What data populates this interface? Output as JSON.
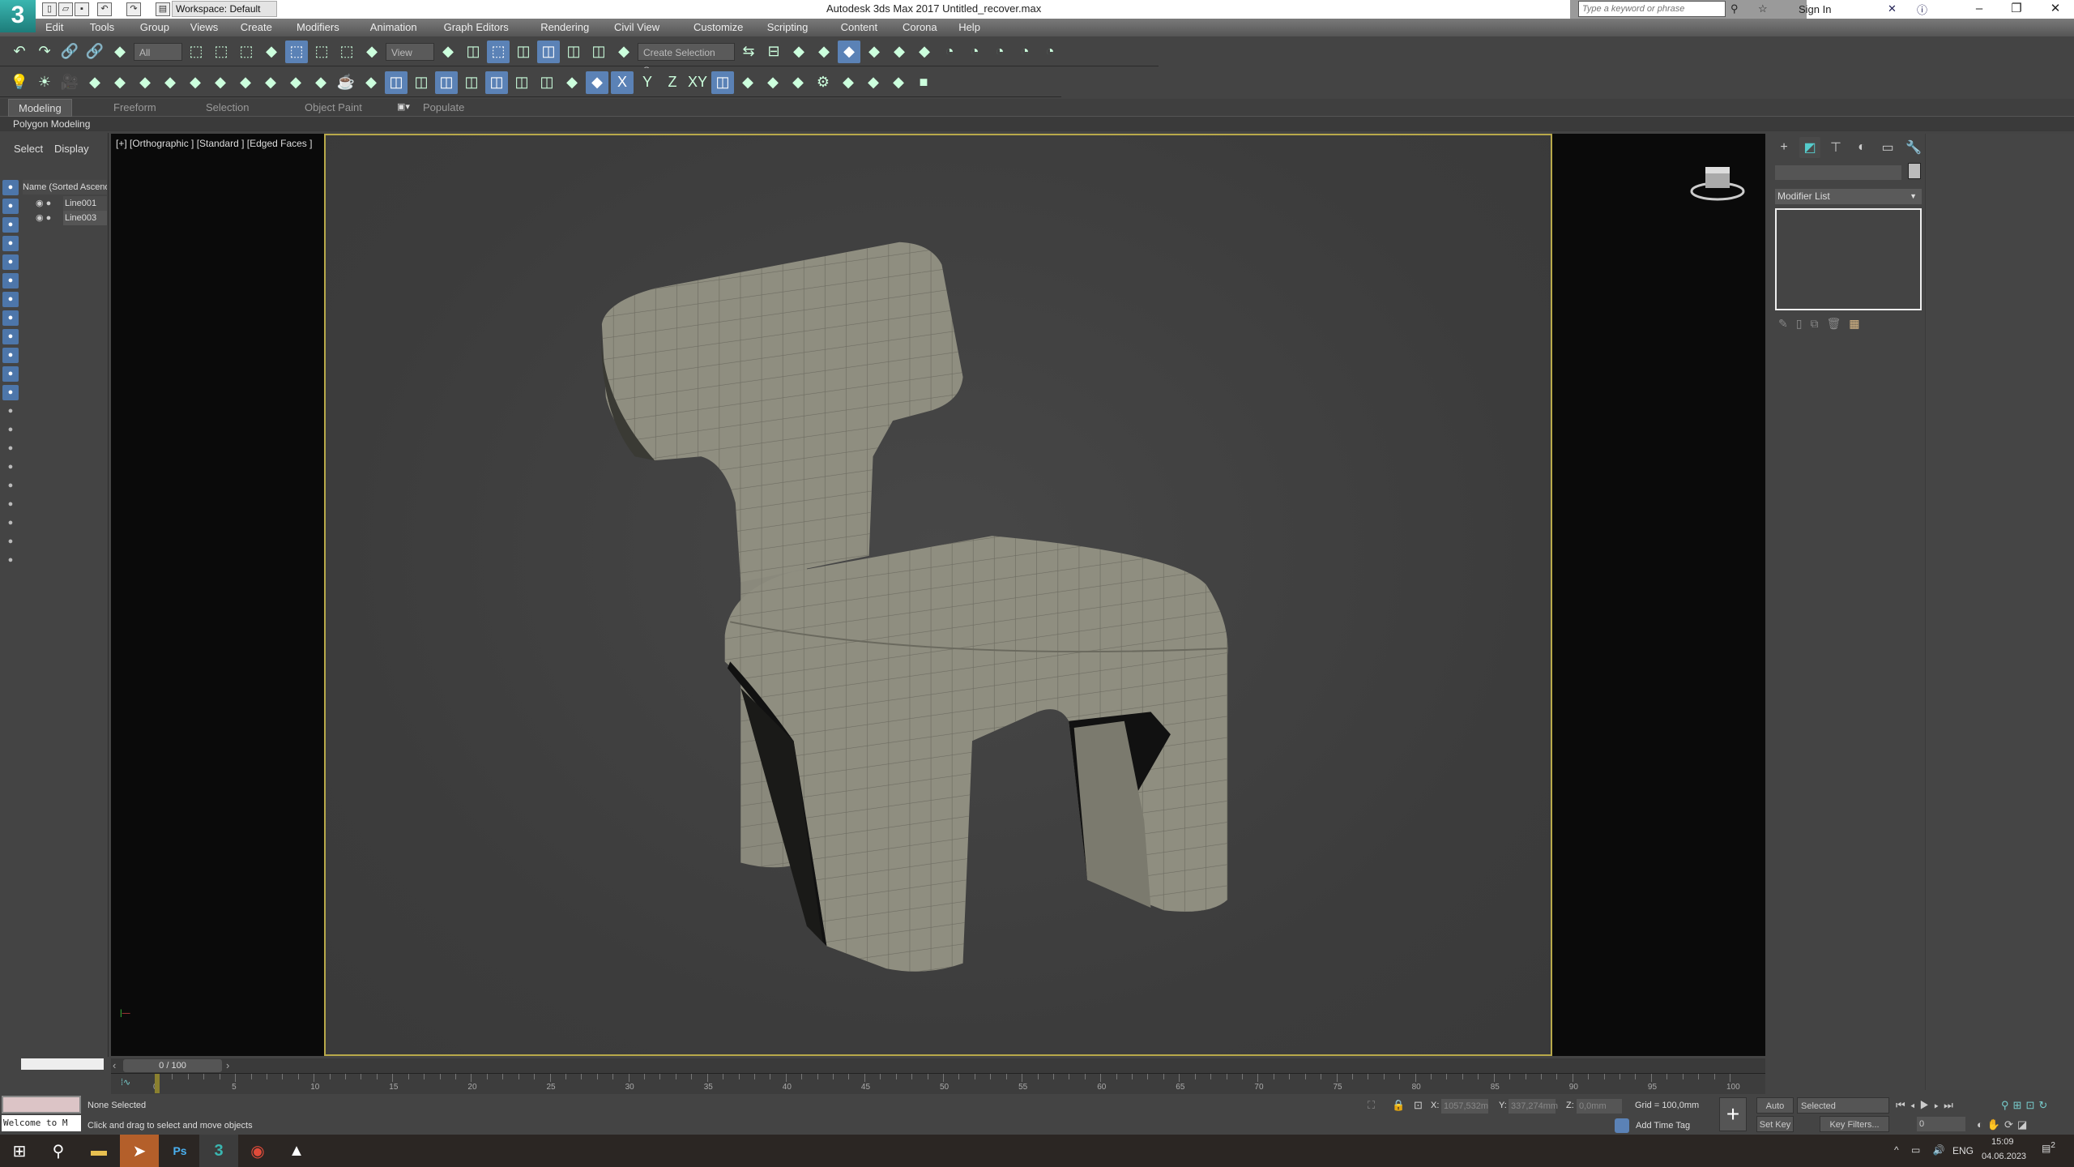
{
  "titlebar": {
    "app_title": "Autodesk 3ds Max 2017   Untitled_recover.max",
    "workspace": "Workspace: Default",
    "search_placeholder": "Type a keyword or phrase",
    "sign_in": "Sign In",
    "logo": "3"
  },
  "menu": [
    "Edit",
    "Tools",
    "Group",
    "Views",
    "Create",
    "Modifiers",
    "Animation",
    "Graph Editors",
    "Rendering",
    "Civil View",
    "Customize",
    "Scripting",
    "Content",
    "Corona",
    "Help"
  ],
  "toolbar1": {
    "selection_filter": "All",
    "ref_coord": "View",
    "named_selection": "Create Selection Se",
    "icons": [
      "undo-icon",
      "redo-icon",
      "link-icon",
      "unlink-icon",
      "bind-space-warp-icon",
      "SEL:select-object-icon",
      "select-by-name-icon",
      "rect-selection-icon",
      "window-crossing-icon",
      "ON:select-move-icon",
      "select-rotate-icon",
      "select-scale-icon",
      "place-icon",
      "REF:pivot-icon",
      "snap-icon",
      "ON:select-manipulate-icon",
      "snap-3d-icon",
      "ON:angle-snap-icon",
      "percent-snap-icon",
      "spinner-snap-icon",
      "edit-named-sel-icon",
      "NS:mirror-icon",
      "align-icon",
      "scene-explorer-icon",
      "layer-explorer-icon",
      "ON:ribbon-toggle-icon",
      "curve-editor-icon",
      "schematic-view-icon",
      "material-editor-icon",
      "render-setup-icon",
      "rendered-frame-icon",
      "render-production-icon",
      "render-iterative-icon",
      "render-cloud-icon"
    ]
  },
  "toolbar2": {
    "icons": [
      "light-icon",
      "sun-icon",
      "camera-icon",
      "tree-icon",
      "list-icon",
      "plant-icon",
      "door-icon",
      "torus-icon",
      "sphere-icon",
      "box-icon",
      "window-icon",
      "helper-icon",
      "panel-icon",
      "teapot-icon",
      "bulb-icon",
      "ON:grid-snap-icon",
      "vertex-snap-icon",
      "ON:pivot-snap-icon",
      "perp-snap-icon",
      "ON:edge-snap-icon",
      "face-snap-icon",
      "tri-snap-icon",
      "freeze-icon",
      "ON:xform-icon",
      "ON:axis-x-icon",
      "axis-y-icon",
      "axis-z-icon",
      "axis-xy-icon",
      "ON:axis-xy-snap-icon",
      "checker-icon",
      "bone-icon",
      "pattern-icon",
      "gear-icon",
      "flask-icon",
      "vase-icon",
      "wand-icon",
      "cube-icon"
    ]
  },
  "ribbon": {
    "tabs": [
      "Modeling",
      "Freeform",
      "Selection",
      "Object Paint",
      "Populate"
    ],
    "panel": "Polygon Modeling"
  },
  "scene_explorer": {
    "tabs": [
      "Select",
      "Display"
    ],
    "column_header": "Name (Sorted Ascending)",
    "items": [
      "Line001",
      "Line003"
    ]
  },
  "viewport": {
    "label": "[+] [Orthographic ] [Standard ] [Edged Faces ]"
  },
  "command_panel": {
    "modifier_list": "Modifier List",
    "tabs": [
      "create-icon",
      "modify-icon",
      "hierarchy-icon",
      "motion-icon",
      "display-icon",
      "utilities-icon"
    ]
  },
  "timeline": {
    "frame": "0 / 100",
    "ticks": [
      "0",
      "5",
      "10",
      "15",
      "20",
      "25",
      "30",
      "35",
      "40",
      "45",
      "50",
      "55",
      "60",
      "65",
      "70",
      "75",
      "80",
      "85",
      "90",
      "95",
      "100"
    ]
  },
  "status": {
    "maxscript": "Welcome to M",
    "selection": "None Selected",
    "prompt": "Click and drag to select and move objects",
    "x_label": "X:",
    "x": "1057,532m",
    "y_label": "Y:",
    "y": "337,274mm",
    "z_label": "Z:",
    "z": "0,0mm",
    "grid": "Grid = 100,0mm",
    "add_time_tag": "Add Time Tag",
    "auto_key": "Auto Key",
    "set_key": "Set Key",
    "key_mode": "Selected",
    "key_filters": "Key Filters...",
    "current_frame": "0"
  },
  "taskbar": {
    "language": "ENG",
    "time": "15:09",
    "date": "04.06.2023",
    "notifications": "2"
  },
  "colors": {
    "accent": "#5b82b6",
    "viewport_border": "#b8a94a",
    "chair": "#8f8e80"
  }
}
